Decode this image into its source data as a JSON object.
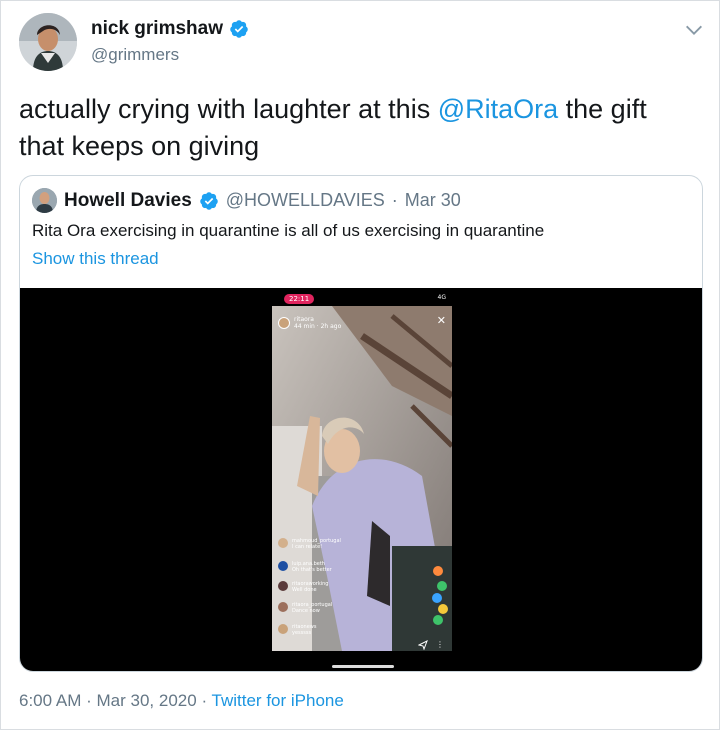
{
  "author": {
    "display_name": "nick grimshaw",
    "handle": "@grimmers"
  },
  "tweet": {
    "text_before": "actually crying with laughter at this ",
    "mention": "@RitaOra",
    "text_after": " the gift that keeps on giving"
  },
  "quoted": {
    "display_name": "Howell Davies",
    "handle": "@HOWELLDAVIES",
    "separator": "·",
    "date": "Mar 30",
    "text": "Rita Ora exercising in quarantine is all of us exercising in quarantine",
    "show_thread": "Show this thread"
  },
  "media_overlay": {
    "status_time": "22:11",
    "status_right": "4G",
    "story_user": "ritaora",
    "story_sub": "44 min · 2h ago",
    "close": "✕",
    "more": "⋮",
    "comments": [
      {
        "user": "mahmoud_portugal",
        "text": "I can relate!"
      },
      {
        "user": "luip.ana.beth",
        "text": "Oh that's better"
      },
      {
        "user": "ritaoraworking",
        "text": "Well done"
      },
      {
        "user": "ritaora_portugal",
        "text": "Dance now"
      },
      {
        "user": "ritaonews",
        "text": "yesssss"
      }
    ]
  },
  "meta": {
    "time": "6:00 AM",
    "separator": "·",
    "date": "Mar 30, 2020",
    "separator2": "·",
    "source": "Twitter for iPhone"
  },
  "colors": {
    "link": "#1b95e0",
    "verified": "#1da1f2",
    "muted": "#657786",
    "text": "#14171a"
  },
  "icons": {
    "verified": "verified-badge-icon",
    "menu": "chevron-down-icon",
    "share": "share-icon"
  }
}
